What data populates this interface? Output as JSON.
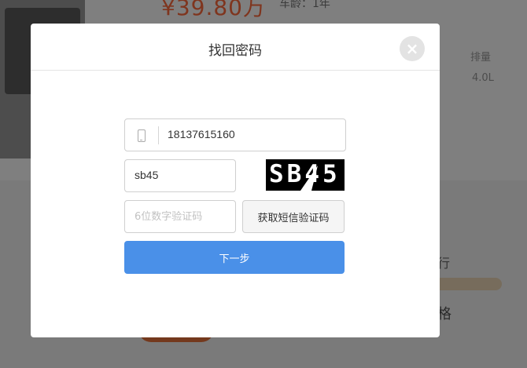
{
  "background": {
    "price": "¥39.80万",
    "age": "车龄：1年",
    "spec_label": "排量",
    "spec_value": "4.0L",
    "side_text_1": "行",
    "side_text_2": "格"
  },
  "modal": {
    "title": "找回密码",
    "close_icon": "close-icon",
    "phone": {
      "icon": "phone-icon",
      "value": "18137615160"
    },
    "captcha": {
      "value": "sb45",
      "image_text": "SB45"
    },
    "sms": {
      "placeholder": "6位数字验证码",
      "value": "",
      "button_label": "获取短信验证码"
    },
    "next_button_label": "下一步"
  },
  "colors": {
    "primary": "#4a90e8",
    "overlay": "rgba(0,0,0,0.5)",
    "price": "#ff6a3d"
  }
}
